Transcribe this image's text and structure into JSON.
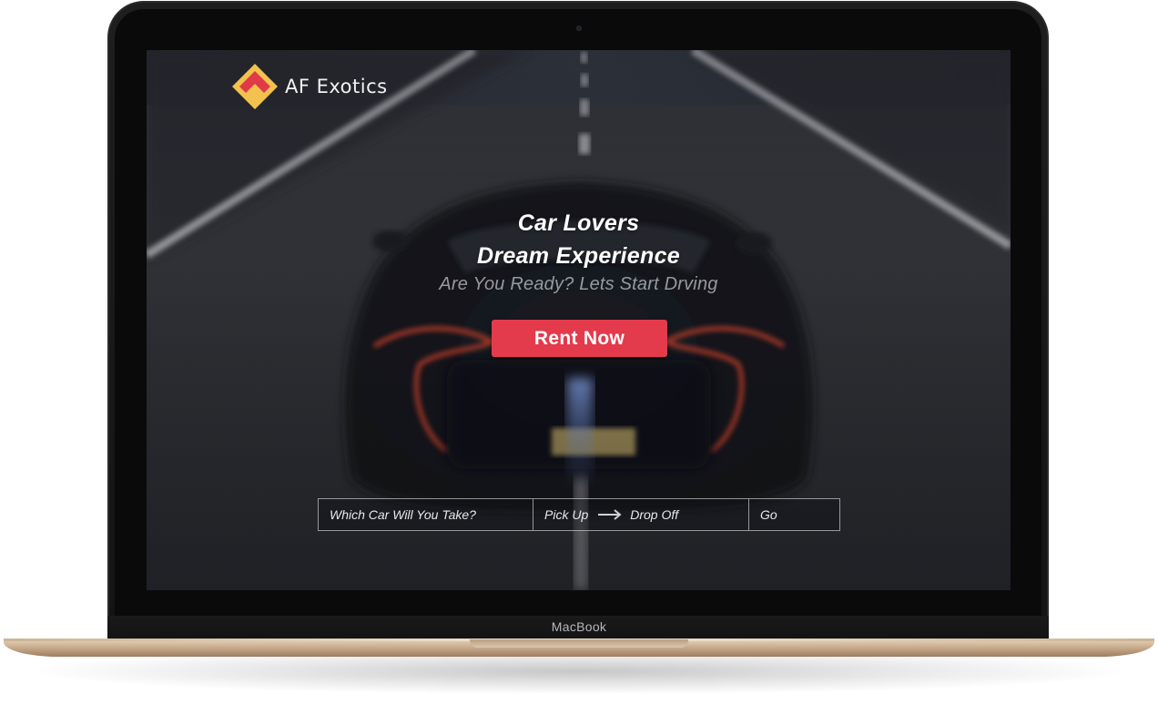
{
  "device": {
    "label": "MacBook"
  },
  "site": {
    "brand_name": "AF Exotics",
    "logo_icon": "diamond-logo-icon",
    "colors": {
      "accent": "#e33b4c",
      "logo_gold": "#f2c14e",
      "logo_red": "#e03a48"
    }
  },
  "hero": {
    "headline_line1": "Car Lovers",
    "headline_line2": "Dream Experience",
    "tagline": "Are You Ready? Lets Start Drving",
    "cta_label": "Rent Now"
  },
  "search": {
    "car_placeholder": "Which Car Will You Take?",
    "pickup_label": "Pick Up",
    "arrow_icon": "arrow-right-icon",
    "dropoff_label": "Drop Off",
    "go_label": "Go"
  }
}
